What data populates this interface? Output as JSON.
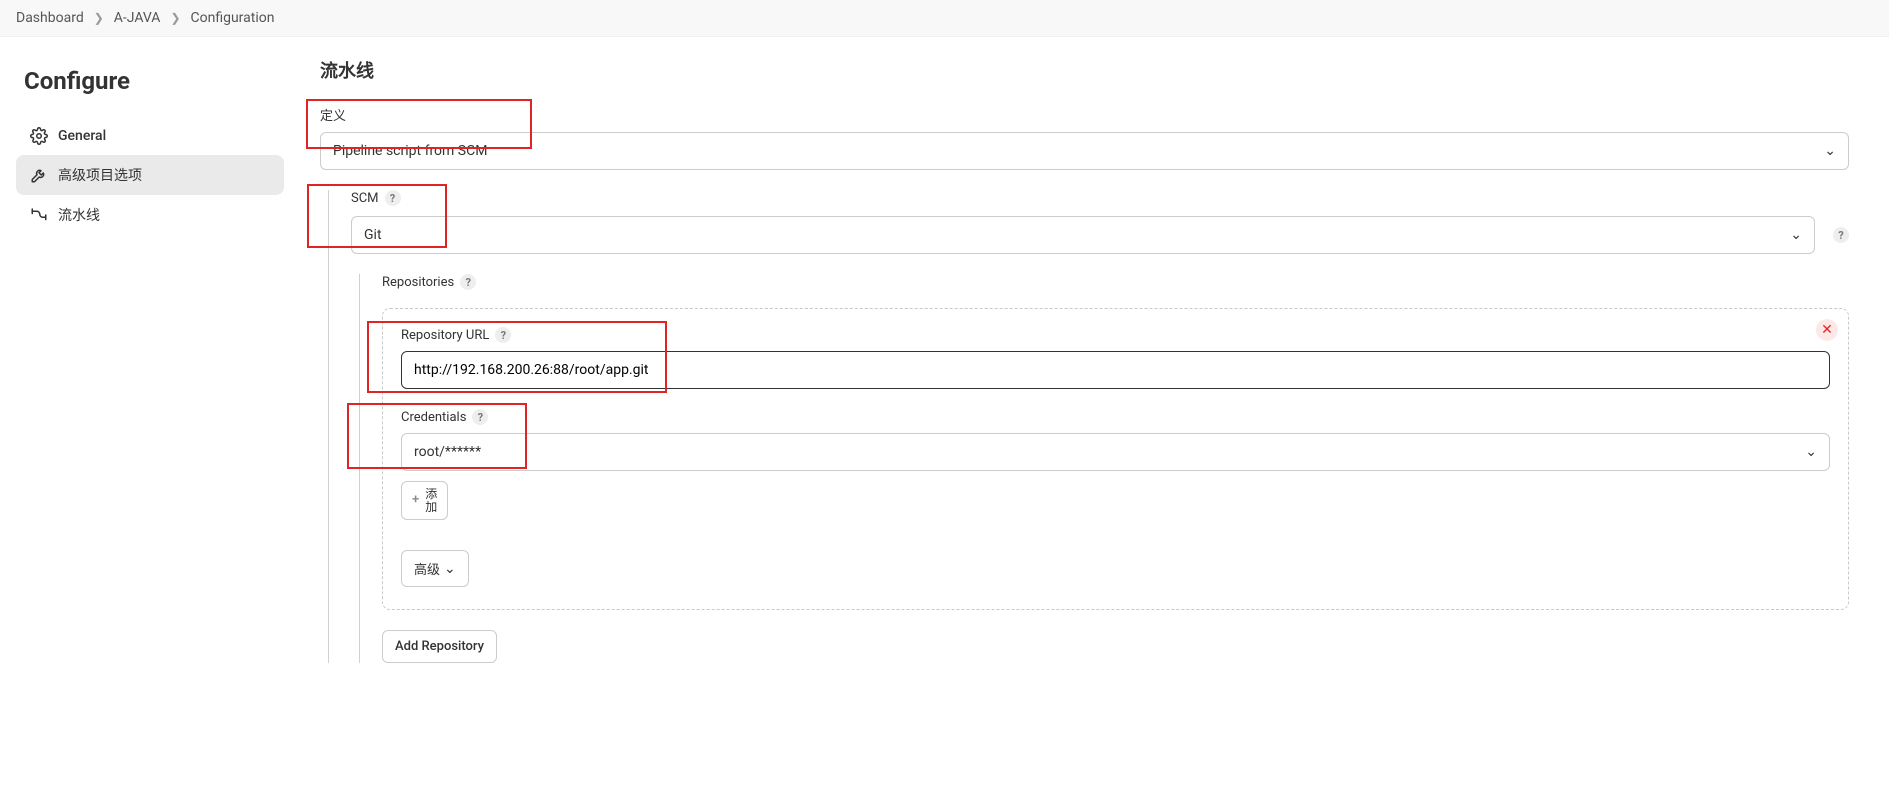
{
  "breadcrumb": {
    "items": [
      "Dashboard",
      "A-JAVA",
      "Configuration"
    ]
  },
  "sidebar": {
    "title": "Configure",
    "items": [
      {
        "label": "General"
      },
      {
        "label": "高级项目选项"
      },
      {
        "label": "流水线"
      }
    ]
  },
  "pipeline": {
    "section_title": "流水线",
    "definition_label": "定义",
    "definition_value": "Pipeline script from SCM",
    "scm_label": "SCM",
    "scm_value": "Git",
    "repositories_label": "Repositories",
    "repo_url_label": "Repository URL",
    "repo_url_value": "http://192.168.200.26:88/root/app.git",
    "credentials_label": "Credentials",
    "credentials_value": "root/******",
    "add_cred_label": "添加",
    "advanced_label": "高级",
    "add_repo_label": "Add Repository"
  }
}
